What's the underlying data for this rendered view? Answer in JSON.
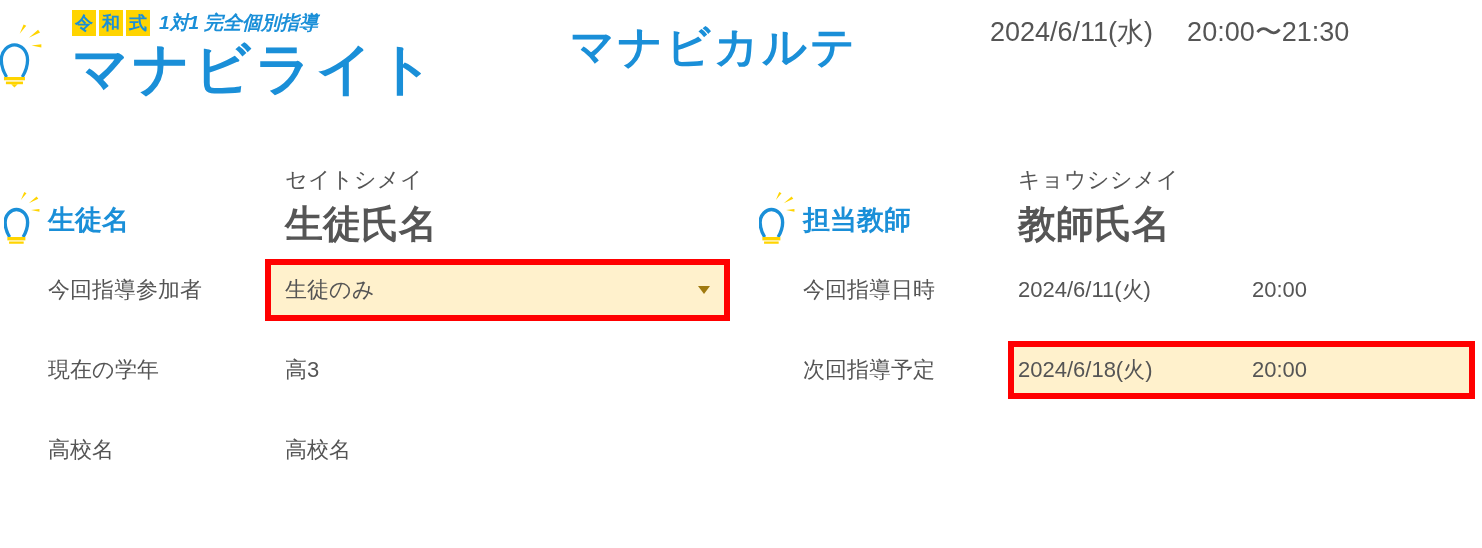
{
  "logo": {
    "badge": [
      "令",
      "和",
      "式"
    ],
    "tagline": "1対1 完全個別指導",
    "name": "マナビライト"
  },
  "title": "マナビカルテ",
  "session_date": "2024/6/11(水)",
  "session_time": "20:00〜21:30",
  "sections": [
    {
      "label": "生徒名",
      "reading": "セイトシメイ",
      "name": "生徒氏名",
      "rows": [
        {
          "label": "今回指導参加者",
          "kind": "select",
          "highlighted": true,
          "value": "生徒のみ"
        },
        {
          "label": "現在の学年",
          "kind": "text",
          "value": "高3"
        },
        {
          "label": "高校名",
          "kind": "text",
          "value": "高校名"
        }
      ]
    },
    {
      "label": "担当教師",
      "reading": "キョウシシメイ",
      "name": "教師氏名",
      "rows": [
        {
          "label": "今回指導日時",
          "kind": "datetime",
          "highlighted": false,
          "date": "2024/6/11(火)",
          "time": "20:00"
        },
        {
          "label": "次回指導予定",
          "kind": "datetime",
          "highlighted": true,
          "date": "2024/6/18(火)",
          "time": "20:00"
        }
      ]
    }
  ]
}
